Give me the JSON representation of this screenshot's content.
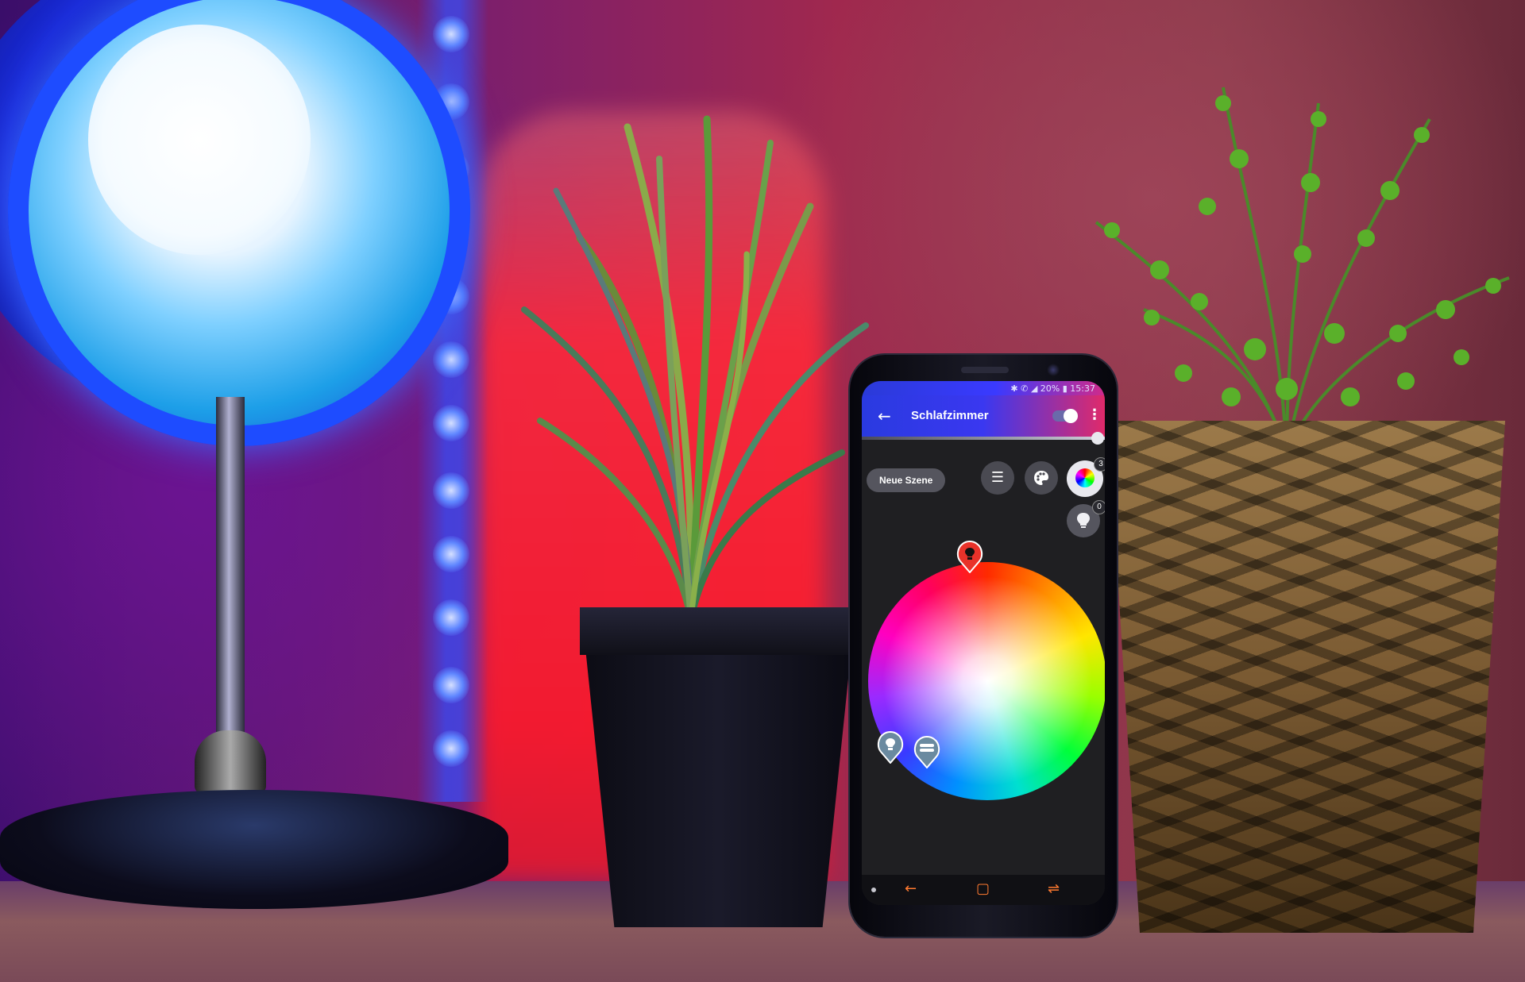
{
  "status_bar": {
    "text": "✱ ✆ ◢ 20% ▮ 15:37"
  },
  "app_bar": {
    "back_icon": "arrow-left-icon",
    "title": "Schlafzimmer",
    "toggle_on": true,
    "menu_icon": "more-vert-icon"
  },
  "brightness": {
    "level": 0.95
  },
  "toolbar": {
    "scene_chip_label": "Neue Szene",
    "list_icon": "list-icon",
    "palette_icon": "palette-icon",
    "color_wheel_icon": "color-wheel-icon",
    "color_wheel_badge": "3",
    "bulb_icon": "bulb-icon",
    "bulb_badge": "0"
  },
  "color_picker": {
    "pins": [
      {
        "icon": "bulb-icon",
        "color": "#e8322a"
      },
      {
        "icon": "bulb-icon",
        "color": "#6a8aa0"
      },
      {
        "icon": "led-strip-icon",
        "color": "#6a8aa0"
      }
    ]
  },
  "nav_bar": {
    "back_icon": "arrow-left-icon",
    "home_icon": "home-icon",
    "recents_icon": "recents-icon"
  },
  "scene_colors": {
    "lamp_light": "#1e4cff",
    "red_lamp": "#ff1a2a",
    "accent_orange": "#ff7a30"
  }
}
